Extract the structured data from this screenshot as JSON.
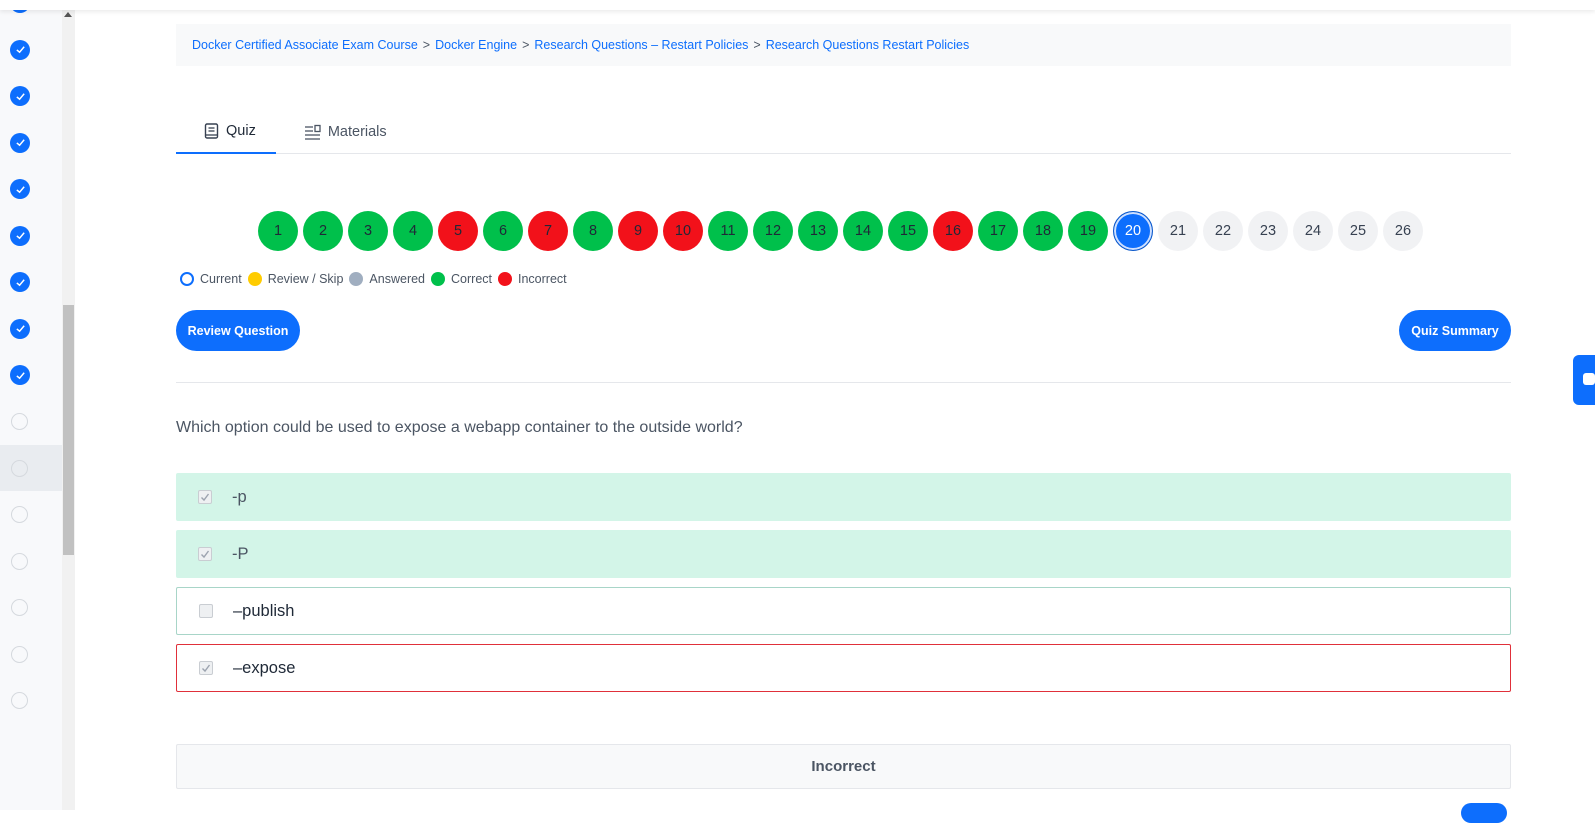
{
  "breadcrumb": {
    "items": [
      "Docker Certified Associate Exam Course",
      "Docker Engine",
      "Research Questions – Restart Policies",
      "Research Questions Restart Policies"
    ],
    "separator": ">"
  },
  "tabs": [
    {
      "label": "Quiz",
      "icon": "book-icon",
      "active": true
    },
    {
      "label": "Materials",
      "icon": "list-icon",
      "active": false
    }
  ],
  "question_nav": [
    {
      "n": "1",
      "status": "correct"
    },
    {
      "n": "2",
      "status": "correct"
    },
    {
      "n": "3",
      "status": "correct"
    },
    {
      "n": "4",
      "status": "correct"
    },
    {
      "n": "5",
      "status": "incorrect"
    },
    {
      "n": "6",
      "status": "correct"
    },
    {
      "n": "7",
      "status": "incorrect"
    },
    {
      "n": "8",
      "status": "correct"
    },
    {
      "n": "9",
      "status": "incorrect"
    },
    {
      "n": "10",
      "status": "incorrect"
    },
    {
      "n": "11",
      "status": "correct"
    },
    {
      "n": "12",
      "status": "correct"
    },
    {
      "n": "13",
      "status": "correct"
    },
    {
      "n": "14",
      "status": "correct"
    },
    {
      "n": "15",
      "status": "correct"
    },
    {
      "n": "16",
      "status": "incorrect"
    },
    {
      "n": "17",
      "status": "correct"
    },
    {
      "n": "18",
      "status": "correct"
    },
    {
      "n": "19",
      "status": "correct"
    },
    {
      "n": "20",
      "status": "current"
    },
    {
      "n": "21",
      "status": "pending"
    },
    {
      "n": "22",
      "status": "pending"
    },
    {
      "n": "23",
      "status": "pending"
    },
    {
      "n": "24",
      "status": "pending"
    },
    {
      "n": "25",
      "status": "pending"
    },
    {
      "n": "26",
      "status": "pending"
    }
  ],
  "legend": {
    "current": "Current",
    "review": "Review / Skip",
    "answered": "Answered",
    "correct": "Correct",
    "incorrect": "Incorrect"
  },
  "buttons": {
    "review_question": "Review Question",
    "quiz_summary": "Quiz Summary"
  },
  "question": {
    "text": "Which option could be used to expose a webapp container to the outside world?",
    "options": [
      {
        "label": "-p",
        "checked": true,
        "state": "correct"
      },
      {
        "label": "-P",
        "checked": true,
        "state": "correct"
      },
      {
        "label": "–publish",
        "checked": false,
        "state": "plain"
      },
      {
        "label": "–expose",
        "checked": true,
        "state": "wrong"
      }
    ]
  },
  "result": "Incorrect",
  "sidebar": {
    "items": [
      "done",
      "done",
      "done",
      "done",
      "done",
      "done",
      "done",
      "done",
      "done",
      "todo",
      "todo-active",
      "todo",
      "todo",
      "todo",
      "todo",
      "todo"
    ]
  },
  "colors": {
    "accent": "#0d6efd",
    "correct": "#00c04b",
    "incorrect": "#f2111a",
    "correct_option_bg": "#d3f5e8"
  }
}
